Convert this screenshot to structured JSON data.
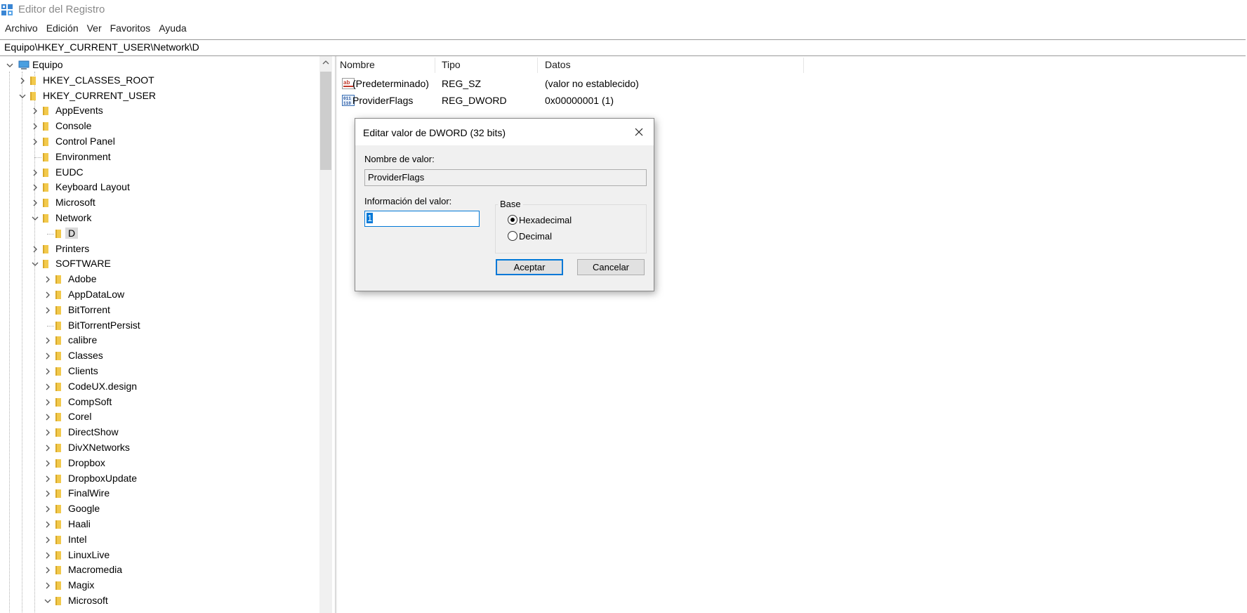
{
  "window": {
    "title": "Editor del Registro",
    "icon": "registry-editor-icon"
  },
  "menu": [
    "Archivo",
    "Edición",
    "Ver",
    "Favoritos",
    "Ayuda"
  ],
  "address": {
    "path": "Equipo\\HKEY_CURRENT_USER\\Network\\D"
  },
  "tree": [
    {
      "label": "Equipo",
      "depth": 0,
      "state": "expanded",
      "icon": "computer-icon"
    },
    {
      "label": "HKEY_CLASSES_ROOT",
      "depth": 1,
      "state": "collapsed"
    },
    {
      "label": "HKEY_CURRENT_USER",
      "depth": 1,
      "state": "expanded"
    },
    {
      "label": "AppEvents",
      "depth": 2,
      "state": "collapsed"
    },
    {
      "label": "Console",
      "depth": 2,
      "state": "collapsed"
    },
    {
      "label": "Control Panel",
      "depth": 2,
      "state": "collapsed"
    },
    {
      "label": "Environment",
      "depth": 2,
      "state": "leaf"
    },
    {
      "label": "EUDC",
      "depth": 2,
      "state": "collapsed"
    },
    {
      "label": "Keyboard Layout",
      "depth": 2,
      "state": "collapsed"
    },
    {
      "label": "Microsoft",
      "depth": 2,
      "state": "collapsed"
    },
    {
      "label": "Network",
      "depth": 2,
      "state": "expanded"
    },
    {
      "label": "D",
      "depth": 3,
      "state": "leaf",
      "selected": true
    },
    {
      "label": "Printers",
      "depth": 2,
      "state": "collapsed"
    },
    {
      "label": "SOFTWARE",
      "depth": 2,
      "state": "expanded"
    },
    {
      "label": "Adobe",
      "depth": 3,
      "state": "collapsed"
    },
    {
      "label": "AppDataLow",
      "depth": 3,
      "state": "collapsed"
    },
    {
      "label": "BitTorrent",
      "depth": 3,
      "state": "collapsed"
    },
    {
      "label": "BitTorrentPersist",
      "depth": 3,
      "state": "leaf"
    },
    {
      "label": "calibre",
      "depth": 3,
      "state": "collapsed"
    },
    {
      "label": "Classes",
      "depth": 3,
      "state": "collapsed"
    },
    {
      "label": "Clients",
      "depth": 3,
      "state": "collapsed"
    },
    {
      "label": "CodeUX.design",
      "depth": 3,
      "state": "collapsed"
    },
    {
      "label": "CompSoft",
      "depth": 3,
      "state": "collapsed"
    },
    {
      "label": "Corel",
      "depth": 3,
      "state": "collapsed"
    },
    {
      "label": "DirectShow",
      "depth": 3,
      "state": "collapsed"
    },
    {
      "label": "DivXNetworks",
      "depth": 3,
      "state": "collapsed"
    },
    {
      "label": "Dropbox",
      "depth": 3,
      "state": "collapsed"
    },
    {
      "label": "DropboxUpdate",
      "depth": 3,
      "state": "collapsed"
    },
    {
      "label": "FinalWire",
      "depth": 3,
      "state": "collapsed"
    },
    {
      "label": "Google",
      "depth": 3,
      "state": "collapsed"
    },
    {
      "label": "Haali",
      "depth": 3,
      "state": "collapsed"
    },
    {
      "label": "Intel",
      "depth": 3,
      "state": "collapsed"
    },
    {
      "label": "LinuxLive",
      "depth": 3,
      "state": "collapsed"
    },
    {
      "label": "Macromedia",
      "depth": 3,
      "state": "collapsed"
    },
    {
      "label": "Magix",
      "depth": 3,
      "state": "collapsed"
    },
    {
      "label": "Microsoft",
      "depth": 3,
      "state": "expanded"
    }
  ],
  "values_pane": {
    "columns": [
      "Nombre",
      "Tipo",
      "Datos"
    ],
    "rows": [
      {
        "icon": "string-value-icon",
        "name": "(Predeterminado)",
        "type": "REG_SZ",
        "data": "(valor no establecido)"
      },
      {
        "icon": "dword-value-icon",
        "name": "ProviderFlags",
        "type": "REG_DWORD",
        "data": "0x00000001 (1)"
      }
    ]
  },
  "dialog": {
    "title": "Editar valor de DWORD (32 bits)",
    "name_label": "Nombre de valor:",
    "name_value": "ProviderFlags",
    "data_label": "Información del valor:",
    "data_value": "1",
    "base_label": "Base",
    "base_options": [
      {
        "label": "Hexadecimal",
        "checked": true
      },
      {
        "label": "Decimal",
        "checked": false
      }
    ],
    "ok_label": "Aceptar",
    "cancel_label": "Cancelar"
  },
  "colors": {
    "folder": "#f2c94c",
    "accent": "#0078d7",
    "selection": "#d9d9d9"
  }
}
